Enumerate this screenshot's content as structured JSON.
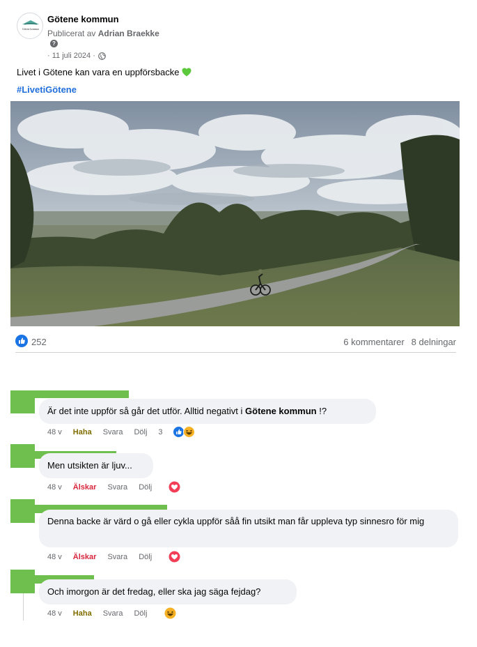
{
  "post": {
    "page_name": "Götene kommun",
    "byline_prefix": "Publicerat av",
    "author": "Adrian Braekke",
    "date": "· 11 juli 2024 ·",
    "text": "Livet i Götene kan vara en uppförsbacke",
    "hashtag": "#LivetiGötene",
    "avatar_text": "Götene kommun"
  },
  "stats": {
    "likes": "252",
    "comments": "6 kommentarer",
    "shares": "8 delningar"
  },
  "comments": [
    {
      "text_pre": "Är det inte uppför så går det utför. Alltid negativt i ",
      "text_bold": "Götene kommun",
      "text_post": " !?",
      "time": "48 v",
      "reaction_label": "Haha",
      "reply": "Svara",
      "hide": "Dölj",
      "reaction_count": "3"
    },
    {
      "text": "Men utsikten är ljuv...",
      "time": "48 v",
      "reaction_label": "Älskar",
      "reply": "Svara",
      "hide": "Dölj"
    },
    {
      "text": "Denna backe är värd o gå eller cykla uppför såå fin utsikt man får uppleva typ sinnesro för mig",
      "time": "48 v",
      "reaction_label": "Älskar",
      "reply": "Svara",
      "hide": "Dölj"
    },
    {
      "text": "Och imorgon är det fredag, eller ska jag säga fejdag?",
      "time": "48 v",
      "reaction_label": "Haha",
      "reply": "Svara",
      "hide": "Dölj"
    }
  ],
  "colors": {
    "link_blue": "#216fdb",
    "like_blue": "#1b74e4",
    "love_red": "#f33e58",
    "haha_yellow": "#f7b125",
    "redaction_green": "#6fbf4e",
    "bubble_bg": "#f0f2f5"
  },
  "icons": [
    "globe-icon",
    "help-icon",
    "green-heart-icon",
    "like-icon",
    "love-icon",
    "haha-icon"
  ]
}
